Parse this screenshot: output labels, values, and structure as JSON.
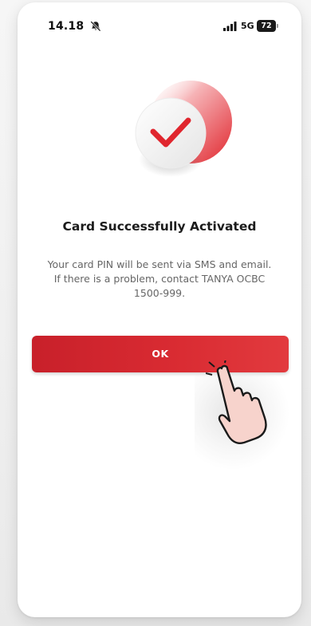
{
  "status_bar": {
    "time": "14.18",
    "network": "5G",
    "battery": "72",
    "icons": [
      "mute-bell-icon",
      "signal-bars-icon",
      "battery-icon"
    ]
  },
  "illustration": {
    "icon": "checkmark-icon",
    "accent_color": "#e3262e"
  },
  "title": "Card Successfully Activated",
  "message": {
    "line1": "Your card PIN will be sent via SMS and email.",
    "line2": "If there is a problem, contact TANYA OCBC",
    "line3": "1500-999."
  },
  "ok_button": {
    "label": "OK",
    "color": "#d92b32"
  },
  "pointer": {
    "icon": "hand-pointer-icon"
  }
}
